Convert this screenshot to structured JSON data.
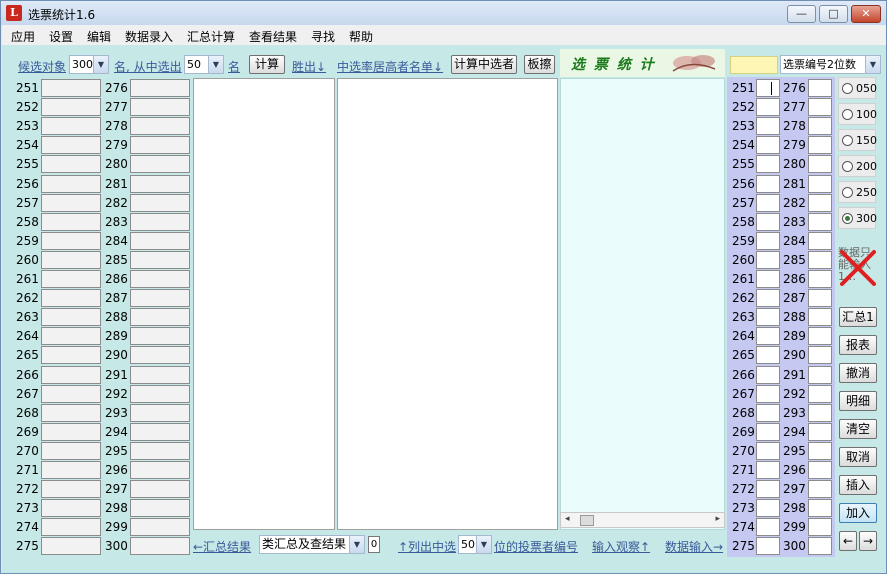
{
  "window": {
    "title": "选票统计1.6",
    "controls": {
      "minimize": "—",
      "maximize": "□",
      "close": "✕"
    }
  },
  "menu": [
    "应用",
    "设置",
    "编辑",
    "数据录入",
    "汇总计算",
    "查看结果",
    "寻找",
    "帮助"
  ],
  "toolbar": {
    "candidates_label": "候选对象",
    "candidates_value": "300",
    "select_label": "名, 从中选出",
    "select_value": "50",
    "unit_label": "名",
    "calc_button": "计算",
    "winners_label": "胜出↓",
    "ranking_label": "中选率居高者名单↓",
    "calc_winners_button": "计算中选者",
    "eraser_button": "板擦",
    "banner_text": "选 票 统 计",
    "voter_id_label": "选票编号2位数"
  },
  "left_rows": {
    "col1": [
      "251",
      "252",
      "253",
      "254",
      "255",
      "256",
      "257",
      "258",
      "259",
      "260",
      "261",
      "262",
      "263",
      "264",
      "265",
      "266",
      "267",
      "268",
      "269",
      "270",
      "271",
      "272",
      "273",
      "274",
      "275"
    ],
    "col2": [
      "276",
      "277",
      "278",
      "279",
      "280",
      "281",
      "282",
      "283",
      "284",
      "285",
      "286",
      "287",
      "288",
      "289",
      "290",
      "291",
      "292",
      "293",
      "294",
      "295",
      "296",
      "297",
      "298",
      "299",
      "300"
    ]
  },
  "right_rows": {
    "col1": [
      "251",
      "252",
      "253",
      "254",
      "255",
      "256",
      "257",
      "258",
      "259",
      "260",
      "261",
      "262",
      "263",
      "264",
      "265",
      "266",
      "267",
      "268",
      "269",
      "270",
      "271",
      "272",
      "273",
      "274",
      "275"
    ],
    "col2": [
      "276",
      "277",
      "278",
      "279",
      "280",
      "281",
      "282",
      "283",
      "284",
      "285",
      "286",
      "287",
      "288",
      "289",
      "290",
      "291",
      "292",
      "293",
      "294",
      "295",
      "296",
      "297",
      "298",
      "299",
      "300"
    ]
  },
  "radios": [
    {
      "label": "050",
      "selected": false
    },
    {
      "label": "100",
      "selected": false
    },
    {
      "label": "150",
      "selected": false
    },
    {
      "label": "200",
      "selected": false
    },
    {
      "label": "250",
      "selected": false
    },
    {
      "label": "300",
      "selected": true
    }
  ],
  "side_notice": "数据只能输入1…",
  "side_buttons": [
    "汇总1",
    "报表",
    "撤消",
    "明细",
    "清空",
    "取消",
    "插入",
    "加入"
  ],
  "nav_buttons": {
    "prev": "←",
    "next": "→"
  },
  "bottom": {
    "summary_link": "←汇总结果",
    "summary_combo": "类汇总及查结果",
    "summary_num": "0",
    "list_label_prefix": "↑列出中选",
    "list_value": "50",
    "list_label_suffix": "位的投票者编号",
    "input_observe": "输入观察↑",
    "data_input": "数据输入→"
  },
  "colors": {
    "main_bg": "#c6e8e6",
    "right_bg": "#c5c8f0",
    "cyan_panel": "#eafcfc",
    "accent_yellow": "#fdf6b4"
  }
}
